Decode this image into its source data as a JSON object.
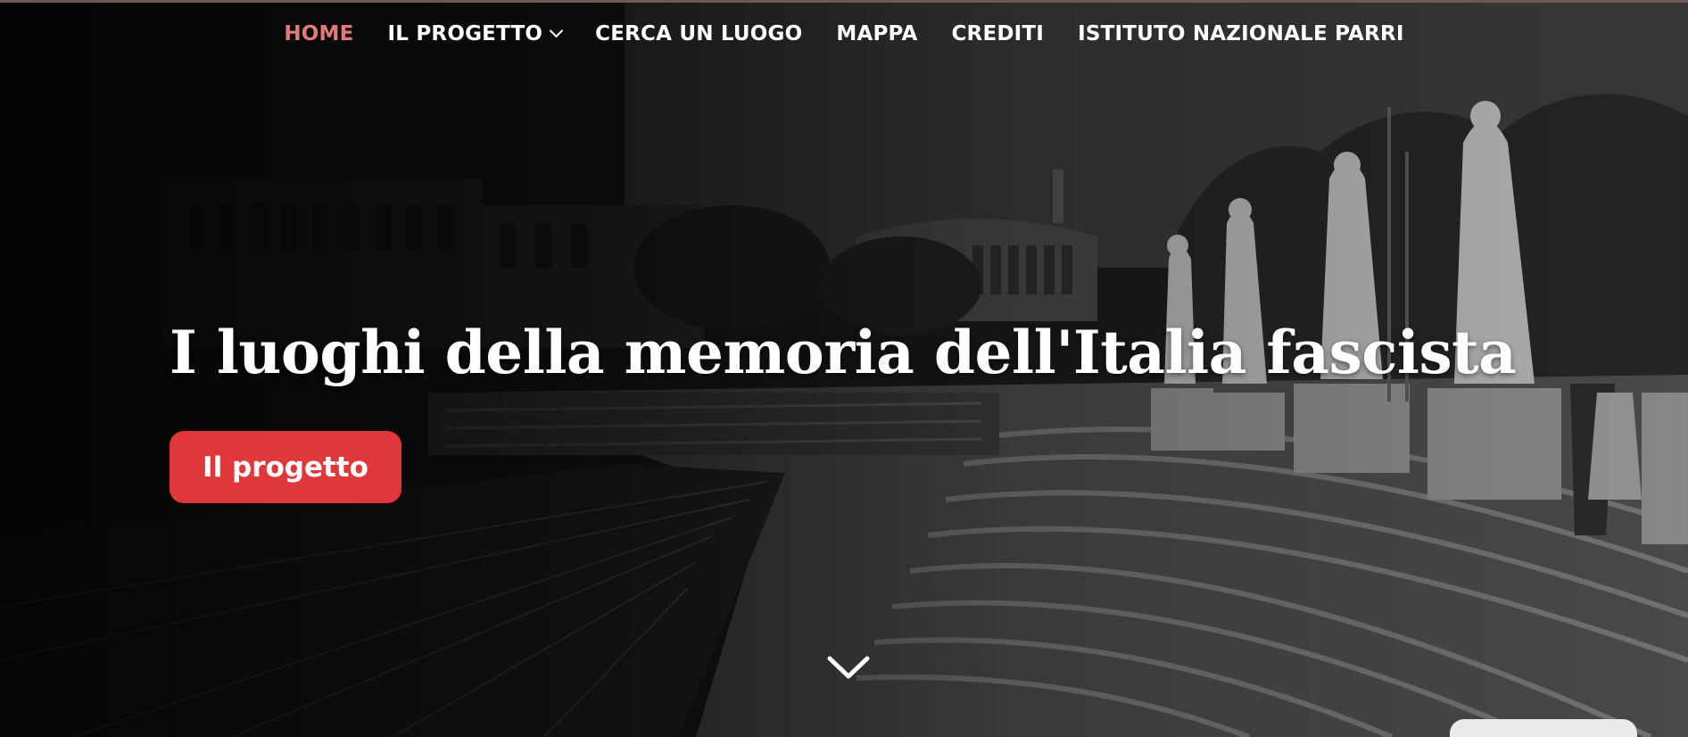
{
  "nav": {
    "items": [
      {
        "label": "HOME",
        "active": true
      },
      {
        "label": "IL PROGETTO",
        "has_dropdown": true
      },
      {
        "label": "CERCA UN LUOGO"
      },
      {
        "label": "MAPPA"
      },
      {
        "label": "CREDITI"
      },
      {
        "label": "ISTITUTO NAZIONALE PARRI"
      }
    ]
  },
  "hero": {
    "title": "I luoghi della memoria dell'Italia fascista",
    "cta_label": "Il progetto",
    "scroll_icon": "chevron-down-icon"
  },
  "colors": {
    "active_nav": "#e27a7a",
    "cta_background": "#e0383a",
    "text": "#ffffff"
  }
}
